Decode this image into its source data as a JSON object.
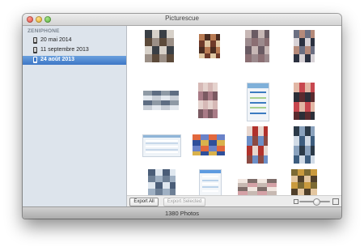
{
  "window": {
    "title": "Picturescue"
  },
  "sidebar": {
    "device": "ZENIPHONE",
    "items": [
      {
        "label": "20 mai 2014",
        "icon": "phone-icon",
        "selected": false
      },
      {
        "label": "11 septembre 2013",
        "icon": "phone-icon",
        "selected": false
      },
      {
        "label": "24 août 2013",
        "icon": "phone-icon",
        "selected": true
      }
    ]
  },
  "toolbar": {
    "export_all": "Export All",
    "export_selected": "Export Selected",
    "zoom_level": 0.55
  },
  "status": {
    "count": "1380 Photos"
  },
  "colors": {
    "selection": "#3d77c6",
    "sidebar_bg": "#dde4ec"
  },
  "photos": [
    {
      "kind": "photo",
      "colors": [
        "#3a3f45",
        "#9b8f86",
        "#d7d1c9",
        "#5c4a3a"
      ]
    },
    {
      "kind": "photo",
      "colors": [
        "#6f3b2a",
        "#b87a52",
        "#e0c7a3",
        "#4a2c20"
      ]
    },
    {
      "kind": "photo",
      "colors": [
        "#6a5b63",
        "#9c8a8d",
        "#c7b7b5",
        "#8b6f73"
      ]
    },
    {
      "kind": "photo",
      "colors": [
        "#2b3140",
        "#b58a7a",
        "#d7d2d6",
        "#6b6f82"
      ]
    },
    {
      "kind": "photo",
      "colors": [
        "#8f9aa5",
        "#c8ced6",
        "#5e6d82",
        "#e3e8ee"
      ]
    },
    {
      "kind": "photo",
      "colors": [
        "#a97b86",
        "#d6b9b6",
        "#7b5a62",
        "#e5d3ce"
      ]
    },
    {
      "kind": "screenshot",
      "colors": [
        "#f1f4f8",
        "#7fb0d9",
        "#a8d08f",
        "#3c7bc0"
      ]
    },
    {
      "kind": "photo",
      "colors": [
        "#5a2a2e",
        "#c7474f",
        "#2b2e38",
        "#e2b7a5"
      ]
    },
    {
      "kind": "screenshot",
      "colors": [
        "#eef3f8",
        "#8fb5d8",
        "#c8d9ea",
        "#ffffff"
      ]
    },
    {
      "kind": "photo",
      "colors": [
        "#2f4f9a",
        "#e2683d",
        "#d9b24c",
        "#6a82c8"
      ]
    },
    {
      "kind": "photo",
      "colors": [
        "#b1322c",
        "#6c8fc7",
        "#e8d7cf",
        "#8b4a43"
      ]
    },
    {
      "kind": "photo",
      "colors": [
        "#3d5d7e",
        "#8aa2bd",
        "#d1dbe6",
        "#2b3a48"
      ]
    },
    {
      "kind": "photo",
      "colors": [
        "#4a5d78",
        "#9fb0c3",
        "#dfe7ef",
        "#6d7f95"
      ]
    },
    {
      "kind": "screenshot",
      "colors": [
        "#f3f6f9",
        "#5e9be0",
        "#bcd3ea",
        "#ffffff"
      ]
    },
    {
      "kind": "photo",
      "colors": [
        "#7e6d6a",
        "#c7b9b2",
        "#f1e6e0",
        "#d4a1a6"
      ]
    },
    {
      "kind": "photo",
      "colors": [
        "#4f3f2a",
        "#c99a3e",
        "#e3c6a0",
        "#7c6a33"
      ]
    }
  ]
}
